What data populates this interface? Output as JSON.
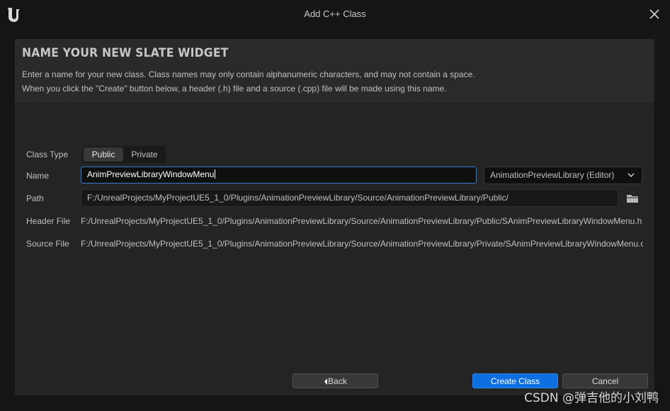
{
  "window": {
    "title": "Add C++ Class",
    "logo_icon": "unreal-logo-icon",
    "close_icon": "close-icon"
  },
  "header": {
    "heading": "NAME YOUR NEW SLATE WIDGET",
    "line1": "Enter a name for your new class. Class names may only contain alphanumeric characters, and may not contain a space.",
    "line2": "When you click the \"Create\" button below, a header (.h) file and a source (.cpp) file will be made using this name."
  },
  "form": {
    "class_type_label": "Class Type",
    "class_type_options": [
      "Public",
      "Private"
    ],
    "class_type_selected": "Public",
    "name_label": "Name",
    "name_value": "AnimPreviewLibraryWindowMenu",
    "module_value": "AnimationPreviewLibrary (Editor)",
    "path_label": "Path",
    "path_value": "F:/UnrealProjects/MyProjectUE5_1_0/Plugins/AnimationPreviewLibrary/Source/AnimationPreviewLibrary/Public/",
    "header_file_label": "Header File",
    "header_file_value": "F:/UnrealProjects/MyProjectUE5_1_0/Plugins/AnimationPreviewLibrary/Source/AnimationPreviewLibrary/Public/SAnimPreviewLibraryWindowMenu.h",
    "source_file_label": "Source File",
    "source_file_value": "F:/UnrealProjects/MyProjectUE5_1_0/Plugins/AnimationPreviewLibrary/Source/AnimationPreviewLibrary/Private/SAnimPreviewLibraryWindowMenu.cpp"
  },
  "buttons": {
    "back": "Back",
    "create": "Create Class",
    "cancel": "Cancel"
  },
  "watermark": "CSDN @弹吉他的小刘鸭",
  "colors": {
    "accent": "#0e70e0",
    "focus_border": "#2f7fd6",
    "panel": "#242424",
    "window": "#151515"
  }
}
